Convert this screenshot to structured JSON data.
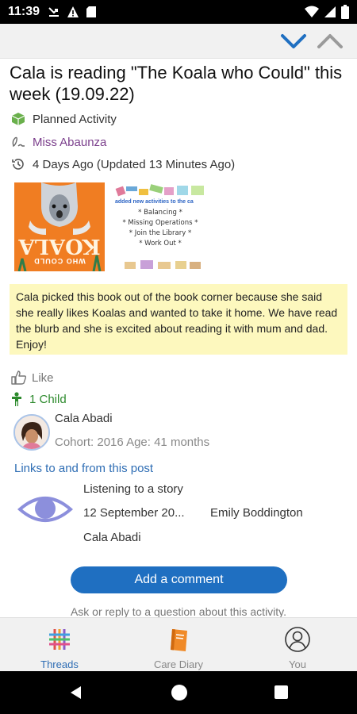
{
  "status_bar": {
    "time": "11:39"
  },
  "post": {
    "title": "Cala is reading \"The Koala who Could\" this week (19.09.22)",
    "type_label": "Planned Activity",
    "author": "Miss Abaunza",
    "time_label": "4 Days Ago (Updated 13 Minutes Ago)",
    "book_cover": {
      "title_text": "KOALA",
      "subtitle_text": "WHO COULD"
    },
    "note_image": {
      "header": "added new activities to the ca",
      "items": [
        "* Balancing *",
        "* Missing Operations *",
        "* Join the Library *",
        "* Work Out *"
      ]
    },
    "note": "Cala picked this book out of the book corner because she said she really likes Koalas and wanted to take it home. We have read the blurb and she is excited about reading it with mum and dad. Enjoy!",
    "like_label": "Like",
    "child_count_label": "1 Child",
    "child": {
      "name": "Cala Abadi",
      "meta": "Cohort: 2016 Age: 41 months"
    },
    "links_heading": "Links to and from this post",
    "linked_post": {
      "title": "Listening to a story",
      "date": "12 September 20...",
      "author": "Emily Boddington",
      "child": "Cala Abadi"
    },
    "add_comment_label": "Add a comment",
    "comment_hint": "Ask or reply to a question about this activity."
  },
  "tabs": [
    {
      "label": "Threads",
      "active": true
    },
    {
      "label": "Care Diary",
      "active": false
    },
    {
      "label": "You",
      "active": false
    }
  ],
  "colors": {
    "accent": "#1f6fc1",
    "link": "#2e6db4",
    "author": "#7b3f8c",
    "child": "#2d8a2d",
    "note_bg": "#fdf8be",
    "book_orange": "#f07d22"
  }
}
